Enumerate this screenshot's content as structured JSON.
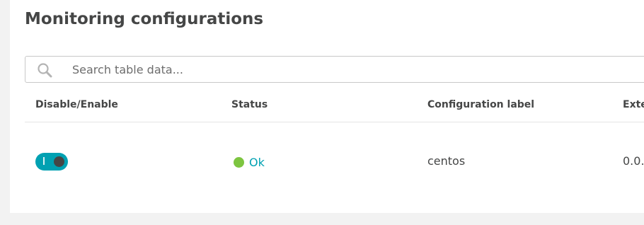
{
  "page": {
    "title": "Monitoring configurations"
  },
  "search": {
    "placeholder": "Search table data...",
    "icon": "search-icon"
  },
  "table": {
    "columns": [
      "Disable/Enable",
      "Status",
      "Configuration label",
      "Exte"
    ],
    "rows": [
      {
        "enabled": true,
        "status": "Ok",
        "configuration_label": "centos",
        "extension_version": "0.0."
      }
    ]
  },
  "colors": {
    "accent": "#00a1b2",
    "status_ok": "#7dc540",
    "text": "#454646",
    "page_background": "#f2f2f2"
  }
}
